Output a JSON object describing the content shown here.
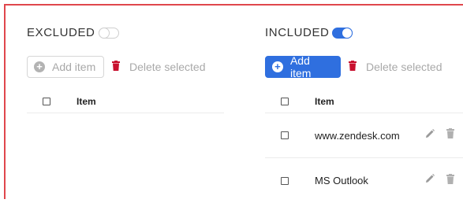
{
  "colors": {
    "accent": "#2f6fdf",
    "danger": "#c8102e",
    "border": "#e0474c",
    "muted": "#a9a9a9"
  },
  "excluded": {
    "title": "EXCLUDED",
    "toggle_state": "off",
    "add_label": "Add item",
    "delete_label": "Delete selected",
    "column_header": "Item",
    "rows": []
  },
  "included": {
    "title": "INCLUDED",
    "toggle_state": "on",
    "add_label": "Add item",
    "delete_label": "Delete selected",
    "column_header": "Item",
    "rows": [
      {
        "label": "www.zendesk.com"
      },
      {
        "label": "MS Outlook"
      }
    ]
  },
  "icons": [
    "plus-circle-icon",
    "trash-icon",
    "pencil-icon",
    "checkbox-icon",
    "toggle-icon"
  ]
}
